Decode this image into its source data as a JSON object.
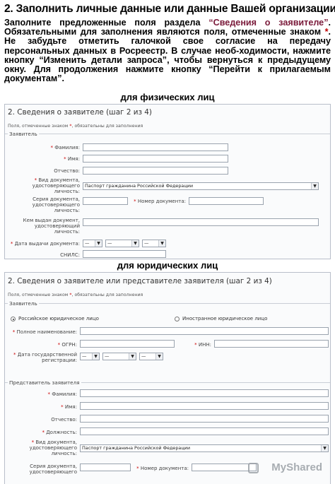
{
  "heading": "2. Заполнить личные данные или данные Вашей организации",
  "intro": {
    "p1": "Заполните предложенные поля раздела ",
    "section_name": "“Сведения о заявителе”",
    "p2": ". Обязательными для заполнения являются поля, отмеченные знаком ",
    "star": "*",
    "p3": ". Не забудьте отметить галочкой свое согласие на передачу персональных данных в Росреестр. В случае необ-ходимости, нажмите кнопку “Изменить детали запроса”, чтобы вернуться к предыдущему окну. Для продолжения нажмите кнопку “Перейти к прилагаемым документам”."
  },
  "sub_individual": "для физических лиц",
  "sub_legal": "для юридических лиц",
  "form1": {
    "title": "2. Сведения о заявителе (шаг 2 из 4)",
    "note_a": "Поля, отмеченные знаком ",
    "note_star": "*",
    "note_b": ", обязательны для заполнения",
    "legend": "Заявитель",
    "labels": {
      "lastname": "Фамилия:",
      "firstname": "Имя:",
      "patronymic": "Отчество:",
      "doctype": "Вид документа, удостоверяющего личность:",
      "docseries": "Серия документа, удостоверяющего личность:",
      "docnumber": "Номер документа:",
      "issuedby": "Кем выдан документ, удостоверяющий личность:",
      "issuedate": "Дата выдачи документа:",
      "snils": "СНИЛС:"
    },
    "doctype_value": "Паспорт гражданина Российской Федерации",
    "date_placeholder": "—"
  },
  "form2": {
    "title": "2. Сведения о заявителе или представителе заявителя (шаг 2 из 4)",
    "note_a": "Поля, отмеченные знаком ",
    "note_star": "*",
    "note_b": ", обязательны для заполнения",
    "legend": "Заявитель",
    "radio_ru": "Российское юридическое лицо",
    "radio_foreign": "Иностранное юридическое лицо",
    "labels": {
      "fullname": "Полное наименование:",
      "ogrn": "ОГРН:",
      "inn": "ИНН:",
      "regdate": "Дата государственной регистрации:"
    },
    "rep_legend": "Представитель заявителя",
    "rep_labels": {
      "lastname": "Фамилия:",
      "firstname": "Имя:",
      "patronymic": "Отчество:",
      "position": "Должность:",
      "doctype": "Вид документа, удостоверяющего личность:",
      "docseries": "Серия документа, удостоверяющего",
      "docnumber": "Номер документа:"
    },
    "doctype_value": "Паспорт гражданина Российской Федерации",
    "date_placeholder": "—"
  },
  "watermark": "MyShared",
  "colors": {
    "accent": "#7a1a3a",
    "required": "#c00000",
    "border": "#b9bfca"
  }
}
